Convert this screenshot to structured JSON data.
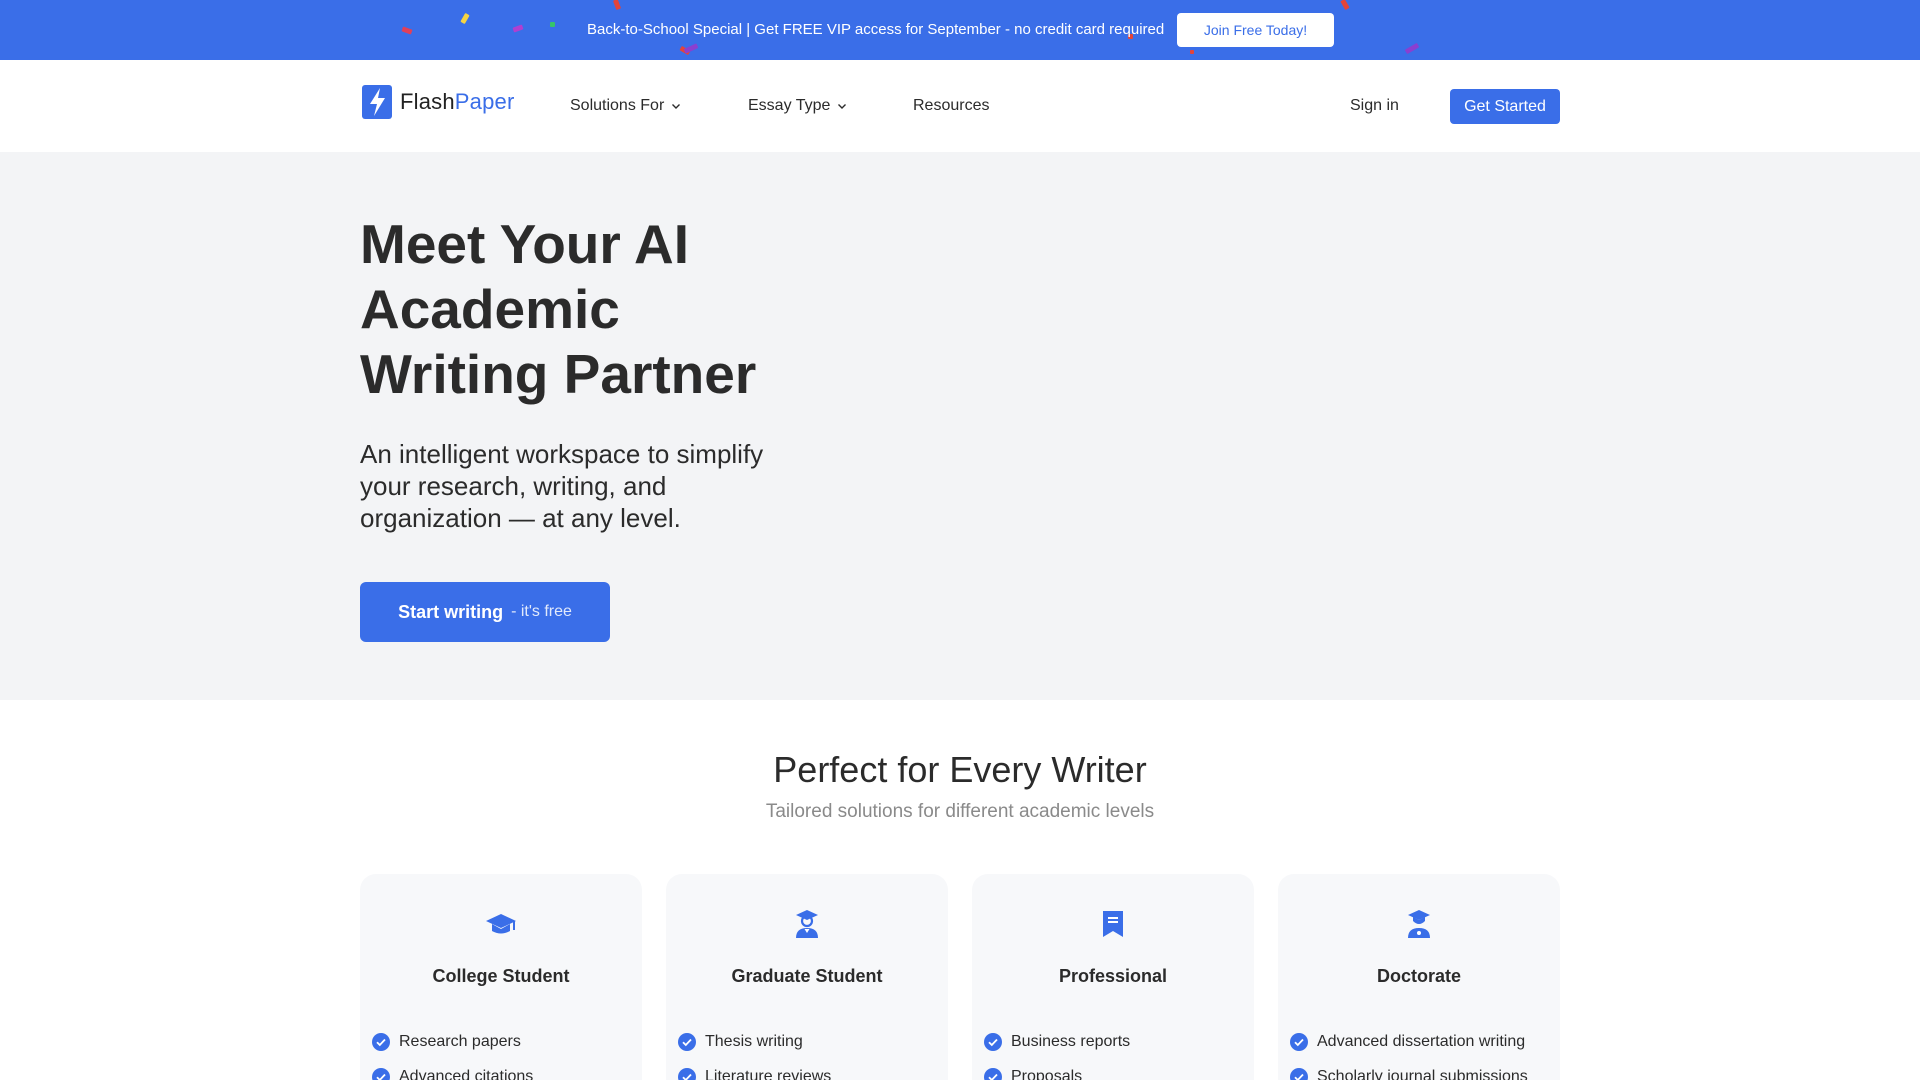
{
  "promo": {
    "text": "Back-to-School Special | Get FREE VIP access for September - no credit card required",
    "cta": "Join Free Today!"
  },
  "header": {
    "logo_part1": "Flash",
    "logo_part2": "Paper",
    "nav": [
      {
        "label": "Solutions For"
      },
      {
        "label": "Essay Type"
      },
      {
        "label": "Resources"
      }
    ],
    "sign_in": "Sign in",
    "get_started": "Get Started"
  },
  "hero": {
    "title": "Meet Your AI Academic Writing Partner",
    "subtitle": "An intelligent workspace to simplify your research, writing, and organization — at any level.",
    "cta_main": "Start writing",
    "cta_extra": "- it's free"
  },
  "section": {
    "title": "Perfect for Every Writer",
    "subtitle": "Tailored solutions for different academic levels"
  },
  "cards": [
    {
      "title": "College Student",
      "icon": "graduation-cap-icon",
      "items": [
        "Research papers",
        "Advanced citations"
      ]
    },
    {
      "title": "Graduate Student",
      "icon": "graduate-person-icon",
      "items": [
        "Thesis writing",
        "Literature reviews"
      ]
    },
    {
      "title": "Professional",
      "icon": "bookmark-book-icon",
      "items": [
        "Business reports",
        "Proposals"
      ]
    },
    {
      "title": "Doctorate",
      "icon": "doctorate-person-icon",
      "items": [
        "Advanced dissertation writing",
        "Scholarly journal submissions"
      ]
    }
  ],
  "colors": {
    "brand": "#3a6ee8",
    "hero_bg": "#f3f4f6",
    "card_bg": "#f7f8fa"
  }
}
